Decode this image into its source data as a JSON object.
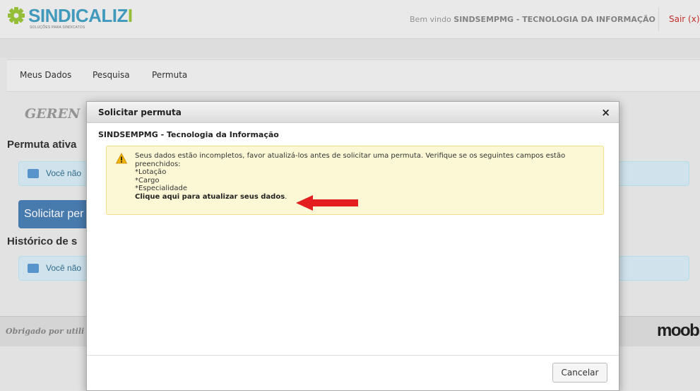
{
  "brand": {
    "name_part1": "SINDICAL",
    "name_part2": "IZ",
    "name_part3": "I",
    "tagline": "SOLUÇÕES PARA SINDICATOS",
    "colors": {
      "blue": "#44a0c4",
      "green": "#9cc63b"
    }
  },
  "header": {
    "welcome_prefix": "Bem vindo",
    "user_name": "SINDSEMPMG - TECNOLOGIA DA INFORMAÇÃO",
    "logout_label": "Sair (x)"
  },
  "nav": {
    "items": [
      {
        "label": "Meus Dados"
      },
      {
        "label": "Pesquisa"
      },
      {
        "label": "Permuta"
      }
    ]
  },
  "background_page": {
    "title_fragment": "GEREN",
    "active_heading_fragment": "Permuta ativa",
    "info1_fragment": "Você não",
    "request_button_fragment": "Solicitar per",
    "history_heading_fragment": "Histórico de s",
    "info2_fragment": "Você não",
    "footer_fragment": "Obrigado por utili",
    "partner_logo_text": "moobi"
  },
  "modal": {
    "title": "Solicitar permuta",
    "close_label": "×",
    "subtitle": "SINDSEMPMG - Tecnologia da Informação",
    "alert": {
      "icon": "warning-icon",
      "line1": "Seus dados estão incompletos, favor atualizá-los antes de solicitar uma permuta. Verifique se os seguintes campos estão",
      "line2": "preenchidos:",
      "field1": "*Lotação",
      "field2": "*Cargo",
      "field3": "*Especialidade",
      "link_text": "Clique aqui para atualizar seus dados",
      "link_suffix": "."
    },
    "cancel_label": "Cancelar"
  }
}
